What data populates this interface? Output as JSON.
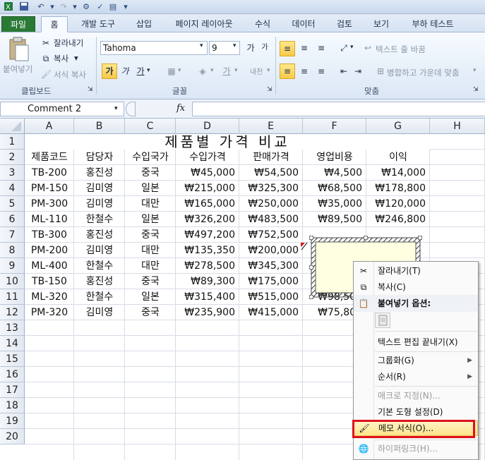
{
  "quick_access": {
    "save_icon": "save-icon",
    "undo_icon": "undo-icon",
    "redo_icon": "redo-icon"
  },
  "tabs": [
    {
      "label": "파일"
    },
    {
      "label": "홈"
    },
    {
      "label": "개발 도구"
    },
    {
      "label": "삽입"
    },
    {
      "label": "페이지 레이아웃"
    },
    {
      "label": "수식"
    },
    {
      "label": "데이터"
    },
    {
      "label": "검토"
    },
    {
      "label": "보기"
    },
    {
      "label": "부하 테스트"
    }
  ],
  "ribbon": {
    "clipboard": {
      "paste": "붙여넣기",
      "cut": "잘라내기",
      "copy": "복사",
      "format_painter": "서식 복사",
      "group": "클립보드"
    },
    "font": {
      "name": "Tahoma",
      "size": "9",
      "group": "글꼴",
      "bold": "가",
      "italic": "가",
      "underline": "가",
      "grow": "가",
      "shrink": "가",
      "phonetic": "내천"
    },
    "alignment": {
      "wrap": "텍스트 줄 바꿈",
      "merge": "병합하고 가운데 맞춤",
      "group": "맞춤"
    }
  },
  "formula_bar": {
    "name_box": "Comment 2",
    "fx": "fx",
    "formula": ""
  },
  "columns": [
    "A",
    "B",
    "C",
    "D",
    "E",
    "F",
    "G",
    "H"
  ],
  "rows": [
    "1",
    "2",
    "3",
    "4",
    "5",
    "6",
    "7",
    "8",
    "9",
    "10",
    "11",
    "12",
    "13",
    "14",
    "15",
    "16",
    "17",
    "18",
    "19",
    "20"
  ],
  "sheet": {
    "title": "제품별 가격 비교",
    "headers": [
      "제품코드",
      "담당자",
      "수입국가",
      "수입가격",
      "판매가격",
      "영업비용",
      "이익"
    ],
    "data": [
      [
        "TB-200",
        "홍진성",
        "중국",
        "₩45,000",
        "₩54,500",
        "₩4,500",
        "₩14,000"
      ],
      [
        "PM-150",
        "김미영",
        "일본",
        "₩215,000",
        "₩325,300",
        "₩68,500",
        "₩178,800"
      ],
      [
        "PM-300",
        "김미영",
        "대만",
        "₩165,000",
        "₩250,000",
        "₩35,000",
        "₩120,000"
      ],
      [
        "ML-110",
        "한철수",
        "일본",
        "₩326,200",
        "₩483,500",
        "₩89,500",
        "₩246,800"
      ],
      [
        "TB-300",
        "홍진성",
        "중국",
        "₩497,200",
        "₩752,500",
        "",
        ""
      ],
      [
        "PM-200",
        "김미영",
        "대만",
        "₩135,350",
        "₩200,000",
        "",
        ""
      ],
      [
        "ML-400",
        "한철수",
        "대만",
        "₩278,500",
        "₩345,300",
        "",
        ""
      ],
      [
        "TB-150",
        "홍진성",
        "중국",
        "₩89,300",
        "₩175,000",
        "",
        ""
      ],
      [
        "ML-320",
        "한철수",
        "일본",
        "₩315,400",
        "₩515,000",
        "₩98,500",
        ""
      ],
      [
        "PM-320",
        "김미영",
        "중국",
        "₩235,900",
        "₩415,000",
        "₩75,800",
        ""
      ]
    ]
  },
  "context_menu": {
    "cut": "잘라내기(T)",
    "copy": "복사(C)",
    "paste_options": "붙여넣기 옵션:",
    "exit_edit": "텍스트 편집 끝내기(X)",
    "group": "그룹화(G)",
    "order": "순서(R)",
    "assign_macro": "매크로 지정(N)...",
    "default_shape": "기본 도형 설정(D)",
    "format_comment": "메모 서식(O)...",
    "hyperlink": "하이퍼링크(H)..."
  },
  "colors": {
    "file_tab": "#2a7a36",
    "highlight_border": "#e0101e",
    "comment_fill": "#ffffe1"
  }
}
